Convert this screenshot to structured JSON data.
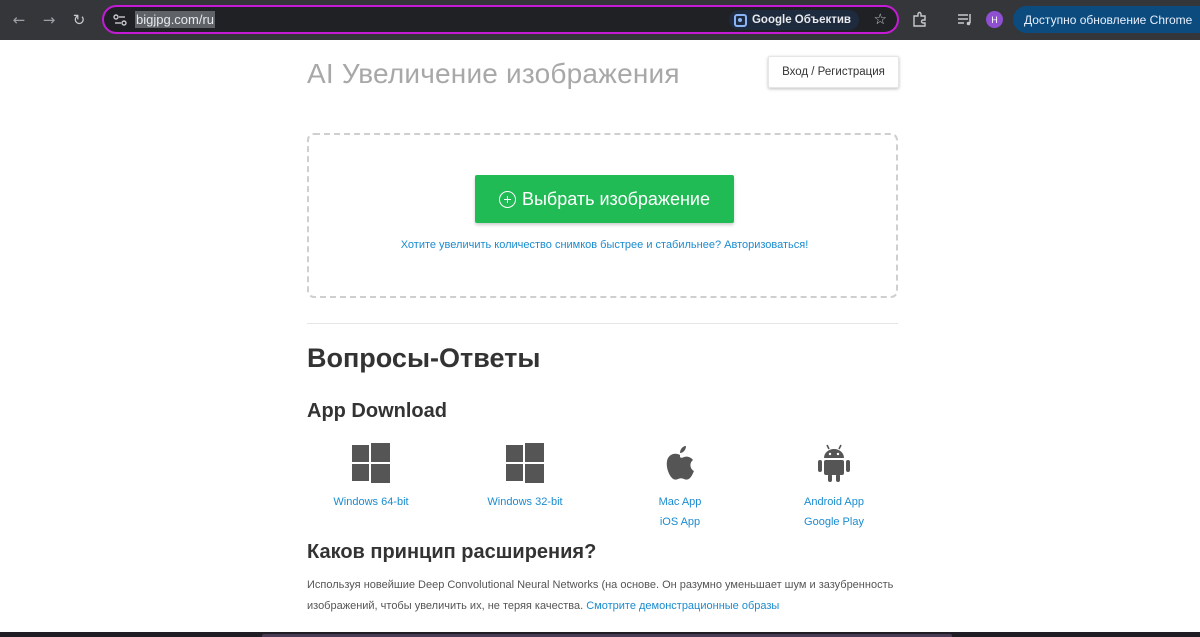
{
  "browser": {
    "url": "bigjpg.com/ru",
    "lens_label": "Google Объектив",
    "avatar_letter": "H",
    "update_label": "Доступно обновление Chrome",
    "icons": [
      "back-icon",
      "forward-icon",
      "reload-icon",
      "site-info-icon",
      "google-lens-icon",
      "bookmark-star-icon",
      "extensions-icon",
      "reading-list-icon",
      "profile-avatar"
    ],
    "colors": {
      "omnibox_border": "#c51bd7",
      "update_button": "#0b4b7d",
      "avatar": "#8e4fd1"
    }
  },
  "header": {
    "title": "AI Увеличение изображения",
    "login_label": "Вход / Регистрация"
  },
  "upload": {
    "button_label": "Выбрать изображение",
    "hint": "Хотите увеличить количество снимков быстрее и стабильнее? Авторизоваться!",
    "button_color": "#21bb55"
  },
  "faq": {
    "title": "Вопросы-Ответы"
  },
  "apps": {
    "title": "App Download",
    "items": [
      {
        "icon": "windows-icon",
        "links": [
          "Windows 64-bit"
        ]
      },
      {
        "icon": "windows-icon",
        "links": [
          "Windows 32-bit"
        ]
      },
      {
        "icon": "apple-icon",
        "links": [
          "Mac App",
          "iOS App"
        ]
      },
      {
        "icon": "android-icon",
        "links": [
          "Android App",
          "Google Play"
        ]
      }
    ]
  },
  "how": {
    "title": "Каков принцип расширения?",
    "text": "Используя новейшие Deep Convolutional Neural Networks (на основе. Он разумно уменьшает шум и зазубренность изображений, чтобы увеличить их, не теряя качества.",
    "link": "Смотрите демонстрационные образы"
  }
}
